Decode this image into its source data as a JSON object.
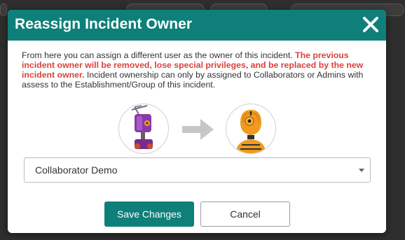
{
  "modal": {
    "title": "Reassign Incident Owner",
    "description_start": "From here you can assign a different user as the owner of this incident. ",
    "description_warning": "The previous incident owner will be removed, lose special privileges, and be replaced by the new incident owner.",
    "description_end": " Incident ownership can only by assigned to Collaborators or Admins with assess to the Establishment/Group of this incident.",
    "current_owner_avatar": "purple-robot-avatar",
    "new_owner_avatar": "orange-robot-avatar",
    "transfer_icon": "arrow-right-icon",
    "close_icon": "close-icon",
    "owner_select": {
      "selected": "Collaborator Demo"
    },
    "save_label": "Save Changes",
    "cancel_label": "Cancel"
  },
  "colors": {
    "header": "#0f7f7a",
    "warning": "#d9423a",
    "primary_button": "#0f7f7a"
  }
}
